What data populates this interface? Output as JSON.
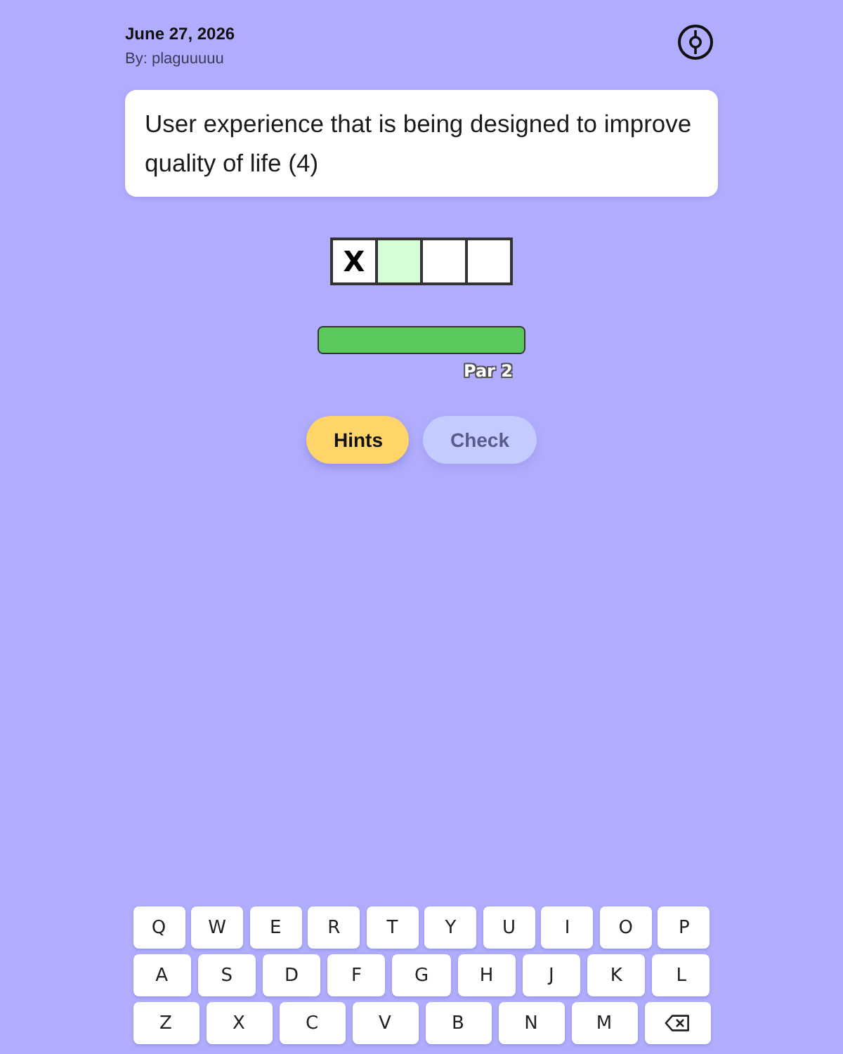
{
  "header": {
    "date": "June 27, 2026",
    "byline": "By: plaguuuuu"
  },
  "clue": {
    "text": "User experience that is being designed to improve quality of life (4)"
  },
  "answer_cells": [
    {
      "value": "X",
      "selected": false
    },
    {
      "selected": true
    },
    {
      "selected": false
    },
    {
      "selected": false
    }
  ],
  "progress": {
    "level": 1,
    "label": "Par 2"
  },
  "buttons": [
    {
      "kind": "hints",
      "label": "Hints",
      "disabled": false
    },
    {
      "kind": "check",
      "label": "Check",
      "disabled": true
    }
  ],
  "keyboard": {
    "rows": [
      {
        "keys": [
          {
            "kind": "letter",
            "label": "Q"
          },
          {
            "kind": "letter",
            "label": "W"
          },
          {
            "kind": "letter",
            "label": "E"
          },
          {
            "kind": "letter",
            "label": "R"
          },
          {
            "kind": "letter",
            "label": "T"
          },
          {
            "kind": "letter",
            "label": "Y"
          },
          {
            "kind": "letter",
            "label": "U"
          },
          {
            "kind": "letter",
            "label": "I"
          },
          {
            "kind": "letter",
            "label": "O"
          },
          {
            "kind": "letter",
            "label": "P"
          }
        ]
      },
      {
        "keys": [
          {
            "kind": "letter",
            "label": "A"
          },
          {
            "kind": "letter",
            "label": "S"
          },
          {
            "kind": "letter",
            "label": "D"
          },
          {
            "kind": "letter",
            "label": "F"
          },
          {
            "kind": "letter",
            "label": "G"
          },
          {
            "kind": "letter",
            "label": "H"
          },
          {
            "kind": "letter",
            "label": "J"
          },
          {
            "kind": "letter",
            "label": "K"
          },
          {
            "kind": "letter",
            "label": "L"
          }
        ]
      },
      {
        "keys": [
          {
            "kind": "letter",
            "label": "Z"
          },
          {
            "kind": "letter",
            "label": "X"
          },
          {
            "kind": "letter",
            "label": "C"
          },
          {
            "kind": "letter",
            "label": "V"
          },
          {
            "kind": "letter",
            "label": "B"
          },
          {
            "kind": "letter",
            "label": "N"
          },
          {
            "kind": "letter",
            "label": "M"
          },
          {
            "kind": "backspace"
          }
        ]
      }
    ]
  }
}
